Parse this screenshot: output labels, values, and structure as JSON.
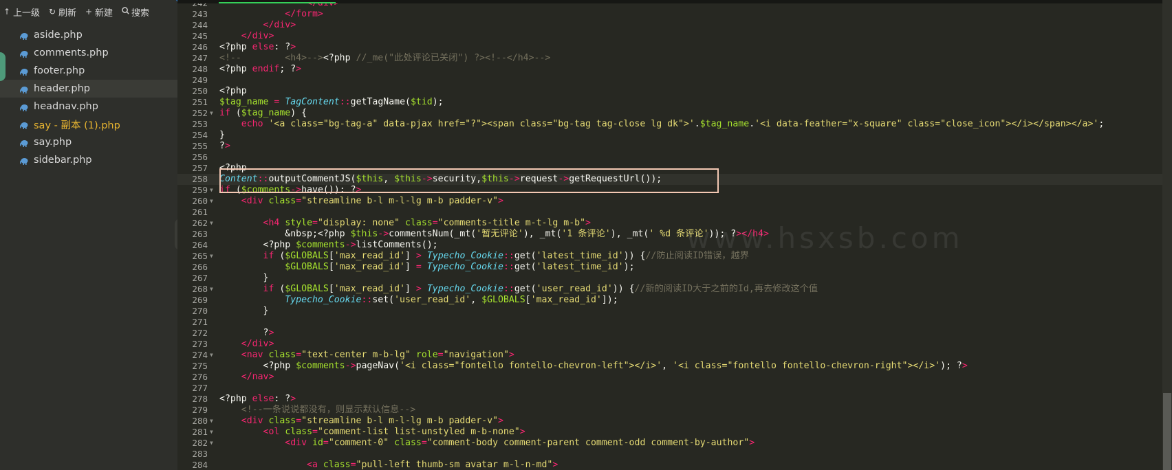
{
  "toolbar": {
    "up": {
      "icon": "arrow-up-icon",
      "label": "上一级"
    },
    "refresh": {
      "icon": "refresh-icon",
      "label": "刷新"
    },
    "new": {
      "icon": "plus-icon",
      "label": "新建"
    },
    "search": {
      "icon": "search-icon",
      "label": "搜索"
    }
  },
  "files": [
    {
      "name": "aside.php",
      "active": false,
      "modified": false
    },
    {
      "name": "comments.php",
      "active": false,
      "modified": false
    },
    {
      "name": "footer.php",
      "active": false,
      "modified": false
    },
    {
      "name": "header.php",
      "active": true,
      "modified": false
    },
    {
      "name": "headnav.php",
      "active": false,
      "modified": false
    },
    {
      "name": "say - 副本 (1).php",
      "active": false,
      "modified": true
    },
    {
      "name": "say.php",
      "active": false,
      "modified": false
    },
    {
      "name": "sidebar.php",
      "active": false,
      "modified": false
    }
  ],
  "file_icon": "elephant-php-icon",
  "colors": {
    "keyword": "#f92672",
    "string": "#e6db74",
    "variable": "#a6e22e",
    "class": "#66d9ef",
    "comment": "#75715e",
    "tag": "#f92672",
    "attr": "#a6e22e",
    "text": "#f8f8f2",
    "modified_file": "#e8b530",
    "highlight_box": "#f4c9b4"
  },
  "watermark": "www.hsxsb.com",
  "current_line": 258,
  "code_lines": [
    {
      "num": 242,
      "fold": false,
      "text": "                </div>"
    },
    {
      "num": 243,
      "fold": false,
      "text": "            </form>"
    },
    {
      "num": 244,
      "fold": false,
      "text": "        </div>"
    },
    {
      "num": 245,
      "fold": false,
      "text": "    </div>"
    },
    {
      "num": 246,
      "fold": false,
      "text": "<?php else: ?>"
    },
    {
      "num": 247,
      "fold": false,
      "text": "<!--        <h4>--><?php //_me(\"此处评论已关闭\") ?><!--</h4>-->"
    },
    {
      "num": 248,
      "fold": false,
      "text": "<?php endif; ?>"
    },
    {
      "num": 249,
      "fold": false,
      "text": ""
    },
    {
      "num": 250,
      "fold": false,
      "text": "<?php"
    },
    {
      "num": 251,
      "fold": false,
      "text": "$tag_name = TagContent::getTagName($tid);"
    },
    {
      "num": 252,
      "fold": true,
      "text": "if ($tag_name) {"
    },
    {
      "num": 253,
      "fold": false,
      "text": "    echo '<a class=\"bg-tag-a\" data-pjax href=\"?\"><span class=\"bg-tag tag-close lg dk\">'.$tag_name.'<i data-feather=\"x-square\" class=\"close_icon\"></i></span></a>';"
    },
    {
      "num": 254,
      "fold": false,
      "text": "}"
    },
    {
      "num": 255,
      "fold": false,
      "text": "?>"
    },
    {
      "num": 256,
      "fold": false,
      "text": ""
    },
    {
      "num": 257,
      "fold": false,
      "text": "<?php"
    },
    {
      "num": 258,
      "fold": false,
      "text": "Content::outputCommentJS($this, $this->security,$this->request->getRequestUrl());"
    },
    {
      "num": 259,
      "fold": true,
      "text": "if ($comments->have()): ?>"
    },
    {
      "num": 260,
      "fold": true,
      "text": "    <div class=\"streamline b-l m-l-lg m-b padder-v\">"
    },
    {
      "num": 261,
      "fold": false,
      "text": ""
    },
    {
      "num": 262,
      "fold": true,
      "text": "        <h4 style=\"display: none\" class=\"comments-title m-t-lg m-b\">"
    },
    {
      "num": 263,
      "fold": false,
      "text": "            &nbsp;<?php $this->commentsNum(_mt('暂无评论'), _mt('1 条评论'), _mt(' %d 条评论')); ?></h4>"
    },
    {
      "num": 264,
      "fold": false,
      "text": "        <?php $comments->listComments();"
    },
    {
      "num": 265,
      "fold": true,
      "text": "        if ($GLOBALS['max_read_id'] > Typecho_Cookie::get('latest_time_id')) {//防止阅读ID错误，越界"
    },
    {
      "num": 266,
      "fold": false,
      "text": "            $GLOBALS['max_read_id'] = Typecho_Cookie::get('latest_time_id');"
    },
    {
      "num": 267,
      "fold": false,
      "text": "        }"
    },
    {
      "num": 268,
      "fold": true,
      "text": "        if ($GLOBALS['max_read_id'] > Typecho_Cookie::get('user_read_id')) {//新的阅读ID大于之前的Id,再去修改这个值"
    },
    {
      "num": 269,
      "fold": false,
      "text": "            Typecho_Cookie::set('user_read_id', $GLOBALS['max_read_id']);"
    },
    {
      "num": 270,
      "fold": false,
      "text": "        }"
    },
    {
      "num": 271,
      "fold": false,
      "text": ""
    },
    {
      "num": 272,
      "fold": false,
      "text": "        ?>"
    },
    {
      "num": 273,
      "fold": false,
      "text": "    </div>"
    },
    {
      "num": 274,
      "fold": true,
      "text": "    <nav class=\"text-center m-b-lg\" role=\"navigation\">"
    },
    {
      "num": 275,
      "fold": false,
      "text": "        <?php $comments->pageNav('<i class=\"fontello fontello-chevron-left\"></i>', '<i class=\"fontello fontello-chevron-right\"></i>'); ?>"
    },
    {
      "num": 276,
      "fold": false,
      "text": "    </nav>"
    },
    {
      "num": 277,
      "fold": false,
      "text": ""
    },
    {
      "num": 278,
      "fold": false,
      "text": "<?php else: ?>"
    },
    {
      "num": 279,
      "fold": false,
      "text": "    <!--一条说说都没有，则显示默认信息-->"
    },
    {
      "num": 280,
      "fold": true,
      "text": "    <div class=\"streamline b-l m-l-lg m-b padder-v\">"
    },
    {
      "num": 281,
      "fold": true,
      "text": "        <ol class=\"comment-list list-unstyled m-b-none\">"
    },
    {
      "num": 282,
      "fold": true,
      "text": "            <div id=\"comment-0\" class=\"comment-body comment-parent comment-odd comment-by-author\">"
    },
    {
      "num": 283,
      "fold": false,
      "text": ""
    },
    {
      "num": 284,
      "fold": false,
      "text": "                <a class=\"pull-left thumb-sm avatar m-l-n-md\">"
    }
  ]
}
